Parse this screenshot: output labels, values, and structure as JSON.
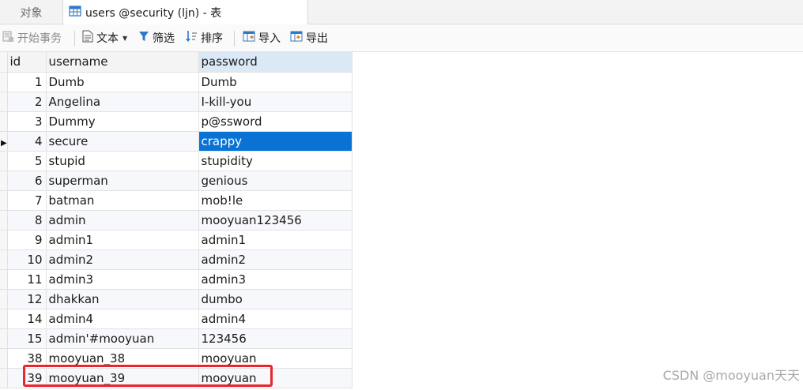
{
  "tabs": {
    "objects_label": "对象",
    "table_label": "users @security (ljn) - 表"
  },
  "toolbar": {
    "begin_transaction": "开始事务",
    "text": "文本",
    "filter": "筛选",
    "sort": "排序",
    "import": "导入",
    "export": "导出"
  },
  "grid": {
    "columns": [
      "id",
      "username",
      "password"
    ],
    "rows": [
      {
        "id": "1",
        "username": "Dumb",
        "password": "Dumb"
      },
      {
        "id": "2",
        "username": "Angelina",
        "password": "I-kill-you"
      },
      {
        "id": "3",
        "username": "Dummy",
        "password": "p@ssword"
      },
      {
        "id": "4",
        "username": "secure",
        "password": "crappy"
      },
      {
        "id": "5",
        "username": "stupid",
        "password": "stupidity"
      },
      {
        "id": "6",
        "username": "superman",
        "password": "genious"
      },
      {
        "id": "7",
        "username": "batman",
        "password": "mob!le"
      },
      {
        "id": "8",
        "username": "admin",
        "password": "mooyuan123456"
      },
      {
        "id": "9",
        "username": "admin1",
        "password": "admin1"
      },
      {
        "id": "10",
        "username": "admin2",
        "password": "admin2"
      },
      {
        "id": "11",
        "username": "admin3",
        "password": "admin3"
      },
      {
        "id": "12",
        "username": "dhakkan",
        "password": "dumbo"
      },
      {
        "id": "14",
        "username": "admin4",
        "password": "admin4"
      },
      {
        "id": "15",
        "username": "admin'#mooyuan",
        "password": "123456"
      },
      {
        "id": "38",
        "username": "mooyuan_38",
        "password": "mooyuan"
      },
      {
        "id": "39",
        "username": "mooyuan_39",
        "password": "mooyuan"
      }
    ],
    "current_row_index": 3,
    "selected_cell": "password",
    "selection_color": "#0a72d4",
    "highlight_color": "#e8262b"
  },
  "watermark": "CSDN @mooyuan天天"
}
